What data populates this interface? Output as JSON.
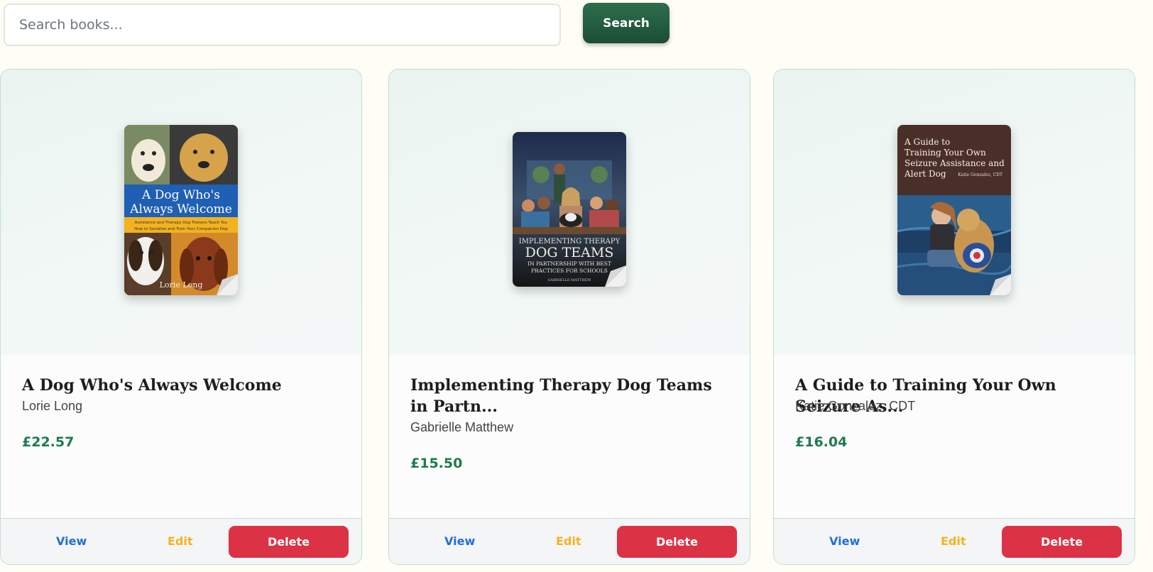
{
  "search": {
    "placeholder": "Search books...",
    "value": "",
    "button_label": "Search"
  },
  "books": [
    {
      "title": "Implementing Therapy Dog Teams in Partn...",
      "author": "Gabrielle Matthew",
      "price": "£15.50",
      "cover_text": [
        "IMPLEMENTING THERAPY",
        "DOG TEAMS",
        "IN PARTNERSHIP WITH BEST",
        "PRACTICES FOR SCHOOLS",
        "GABRIELLE MATTHEW"
      ]
    },
    {
      "title": "A Guide to Training Your Own Seizure As...",
      "author": "Katie Gonzalez, CDT",
      "price": "£16.04",
      "cover_text": [
        "A Guide to",
        "Training Your Own",
        "Seizure Assistance and",
        "Alert Dog",
        "Katie Gonzalez, CDT"
      ]
    },
    {
      "title": "A Dog Who's Always Welcome",
      "author": "Lorie Long",
      "price": "£22.57",
      "cover_text": [
        "A Dog Who's",
        "Always Welcome",
        "Assistance and Therapy Dog Trainers Teach You",
        "How to Socialize and Train Your Companion Dog",
        "Lorie Long"
      ]
    }
  ],
  "actions": {
    "view_label": "View",
    "edit_label": "Edit",
    "delete_label": "Delete"
  },
  "colors": {
    "page_background": "#fefef6",
    "search_button": "#1c4d35",
    "price": "#1f7a4d",
    "view": "#1f6fd6",
    "edit": "#f2b320",
    "delete": "#dc3245",
    "card_border": "#bfe0cc"
  }
}
